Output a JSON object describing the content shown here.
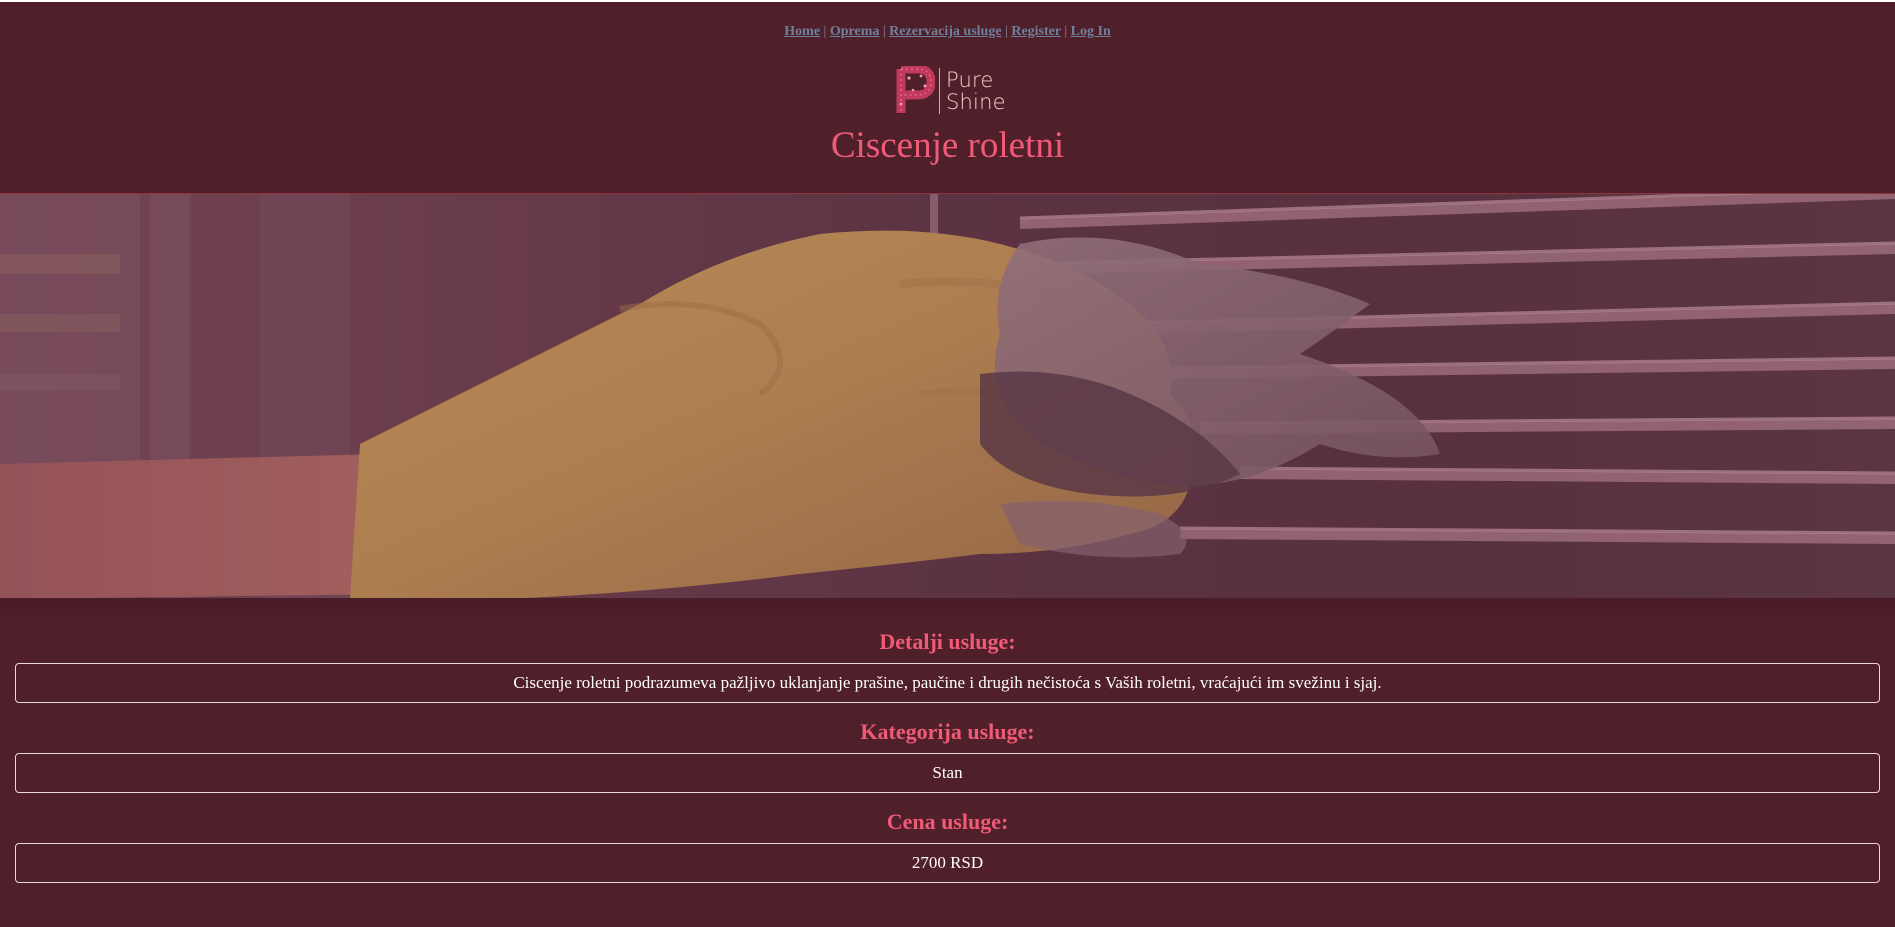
{
  "nav": {
    "links": [
      "Home",
      "Oprema",
      "Rezervacija usluge",
      "Register",
      "Log In"
    ],
    "separator": "|"
  },
  "logo": {
    "line1": "Pure",
    "line2": "Shine"
  },
  "page": {
    "title": "Ciscenje roletni"
  },
  "sections": {
    "details_title": "Detalji usluge:",
    "details_value": "Ciscenje roletni podrazumeva pažljivo uklanjanje prašine, paučine i drugih nečistoća s Vaših roletni, vraćajući im svežinu i sjaj.",
    "category_title": "Kategorija usluge:",
    "category_value": "Stan",
    "price_title": "Cena usluge:",
    "price_value": "2700 RSD"
  },
  "colors": {
    "background": "#4f1f2a",
    "accent": "#ef5b77",
    "nav_link": "#6f7f9c",
    "box_border": "#e9d7da"
  },
  "icons": {
    "logo_mark": "ornate-letter-p-icon"
  }
}
